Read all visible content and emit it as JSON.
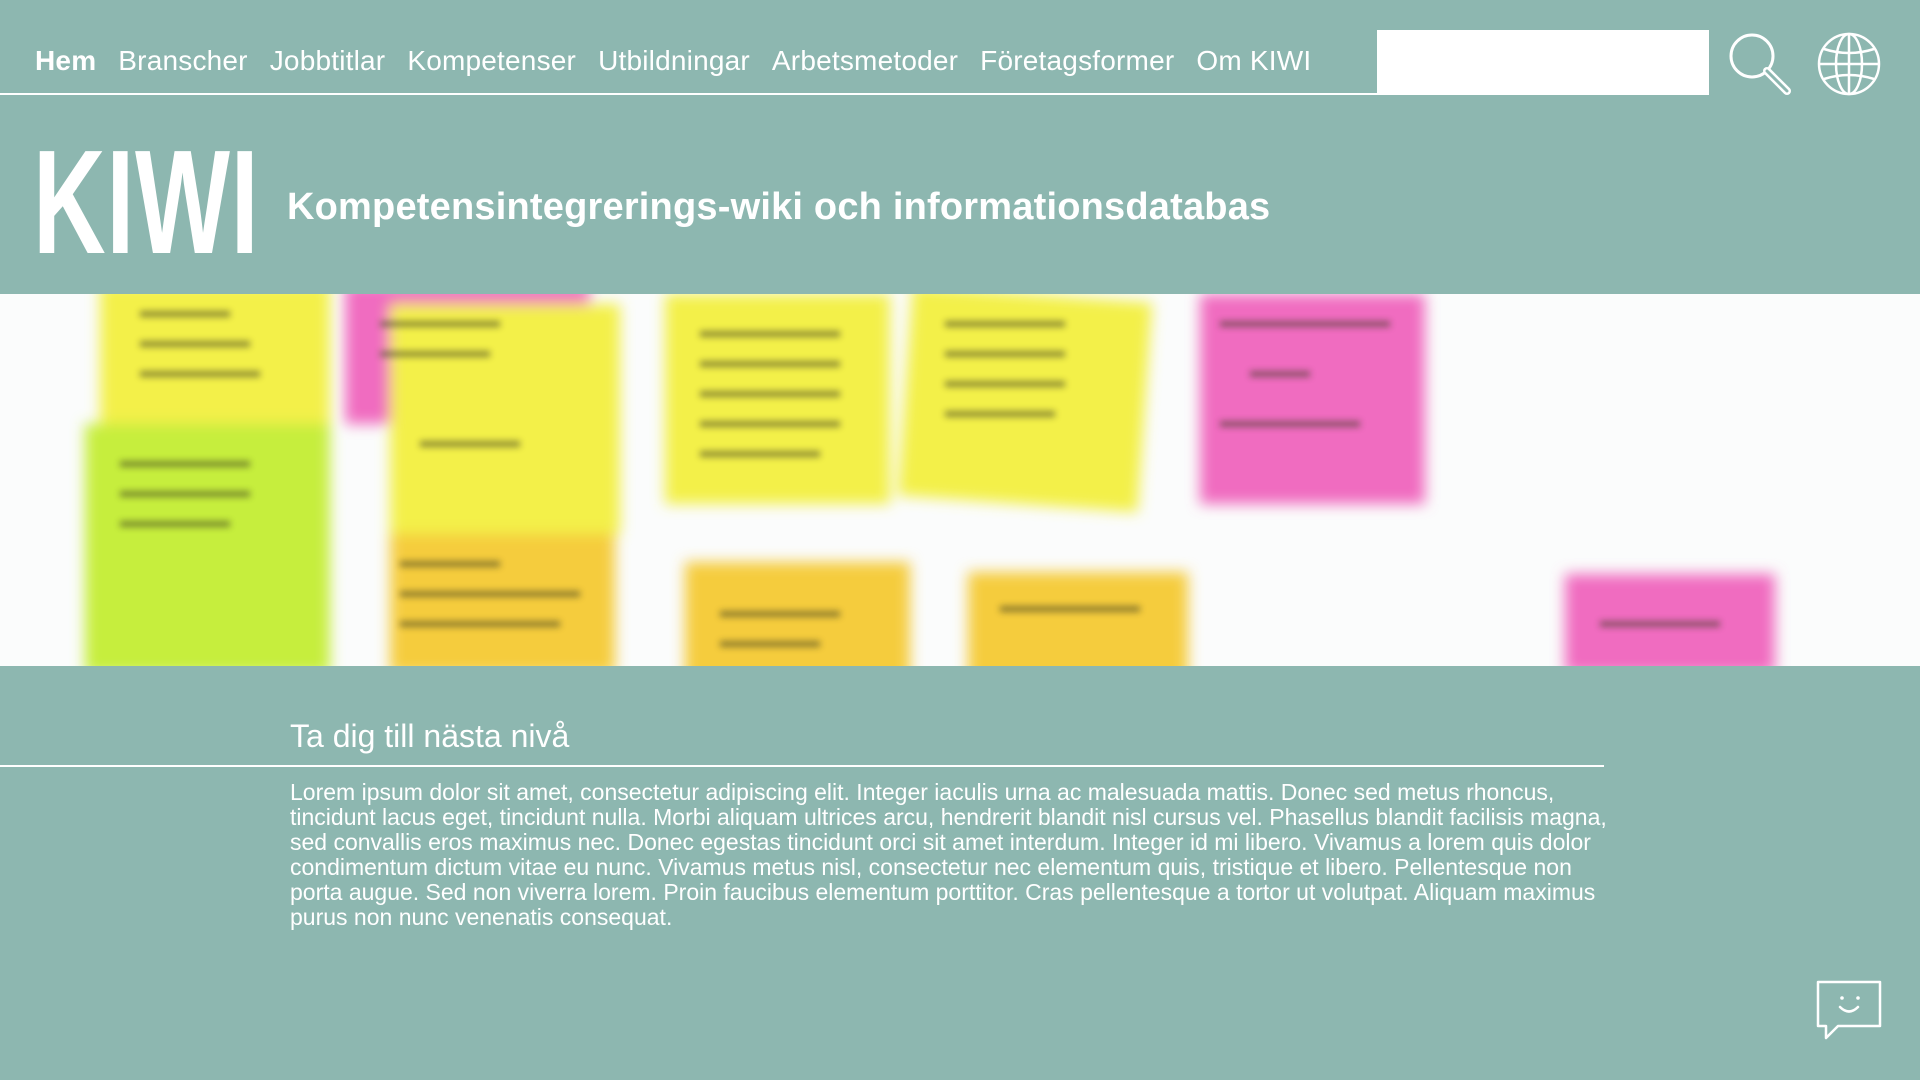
{
  "nav": {
    "items": [
      {
        "label": "Hem",
        "active": true
      },
      {
        "label": "Branscher",
        "active": false
      },
      {
        "label": "Jobbtitlar",
        "active": false
      },
      {
        "label": "Kompetenser",
        "active": false
      },
      {
        "label": "Utbildningar",
        "active": false
      },
      {
        "label": "Arbetsmetoder",
        "active": false
      },
      {
        "label": "Företagsformer",
        "active": false
      },
      {
        "label": "Om KIWI",
        "active": false
      }
    ],
    "search": {
      "value": "",
      "icon": "search-icon"
    },
    "language_icon": "globe-icon"
  },
  "header": {
    "brand": "KIWI",
    "tagline": "Kompetensintegrerings-wiki och informationsdatabas"
  },
  "section": {
    "title": "Ta dig till nästa nivå",
    "body": "Lorem ipsum dolor sit amet, consectetur adipiscing elit. Integer iaculis urna ac malesuada mattis. Donec sed metus rhoncus, tincidunt lacus eget, tincidunt nulla. Morbi aliquam ultrices arcu, hendrerit blandit nisl cursus vel. Phasellus blandit facilisis magna, sed convallis eros maximus nec. Donec egestas tincidunt orci sit amet interdum. Integer id mi libero. Vivamus a lorem quis dolor condimentum dictum vitae eu nunc. Vivamus metus nisl, consectetur nec elementum quis, tristique et libero. Pellentesque non porta augue. Sed non viverra lorem. Proin faucibus elementum porttitor. Cras pellentesque a tortor ut volutpat. Aliquam maximus purus non nunc venenatis consequat."
  },
  "chat": {
    "icon": "chat-icon"
  },
  "colors": {
    "background": "#8db7b0",
    "text": "#ffffff",
    "note_yellow": "#f3f04a",
    "note_pink": "#f06cc0",
    "note_lime": "#c6ee3c",
    "note_orange": "#f5cc3e"
  }
}
